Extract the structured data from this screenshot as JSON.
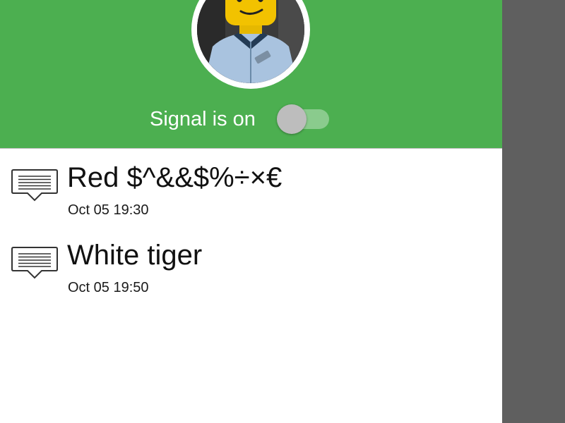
{
  "header": {
    "avatar_alt": "Lego construction worker avatar",
    "signal_label": "Signal is on",
    "signal_toggle_on": false,
    "background_color": "#4caf50"
  },
  "messages": [
    {
      "icon": "message-icon",
      "title": "Red $^&&$%÷×€",
      "time": "Oct 05 19:30"
    },
    {
      "icon": "message-icon",
      "title": "White tiger",
      "time": "Oct 05 19:50"
    }
  ]
}
